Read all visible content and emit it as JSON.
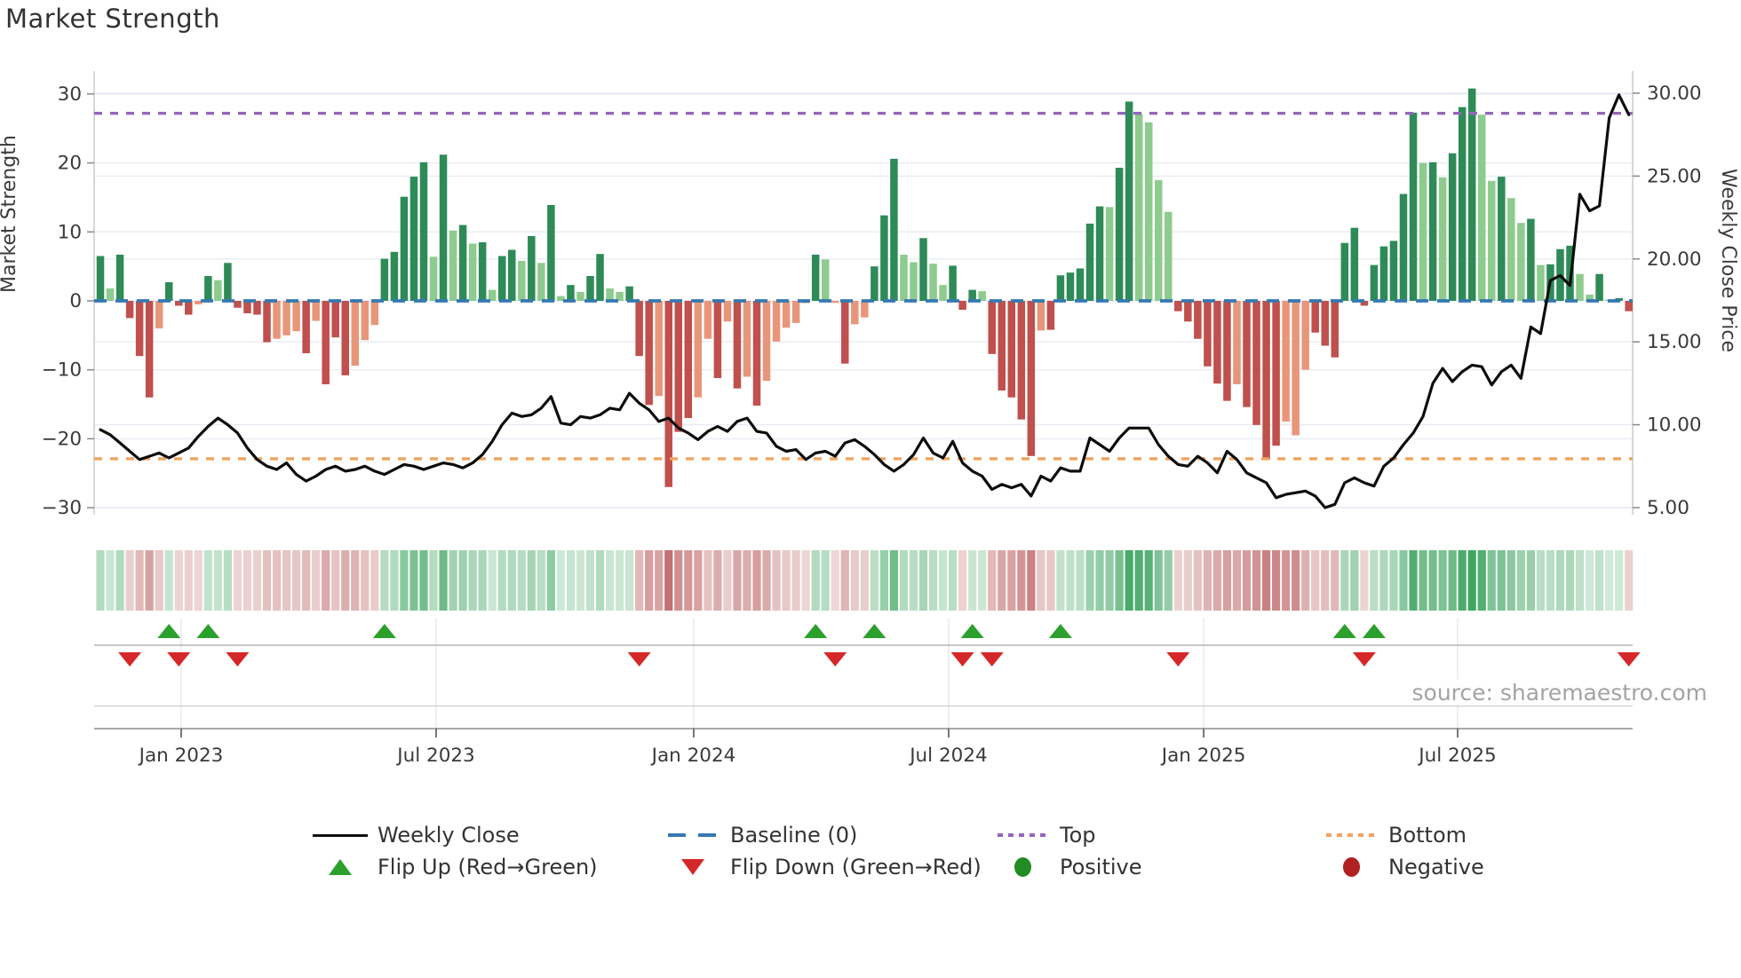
{
  "title": "Market Strength",
  "source_note": "source: sharemaestro.com",
  "axes": {
    "left_title": "Market Strength",
    "right_title": "Weekly Close Price",
    "left_tick_labels": [
      "30",
      "20",
      "10",
      "0",
      "−10",
      "−20",
      "−30"
    ],
    "left_tick_values": [
      30,
      20,
      10,
      0,
      -10,
      -20,
      -30
    ],
    "right_tick_labels": [
      "30.00",
      "25.00",
      "20.00",
      "15.00",
      "10.00",
      "5.00"
    ],
    "right_tick_values": [
      30,
      25,
      20,
      15,
      10,
      5
    ],
    "x_tick_labels": [
      "Jan 2023",
      "Jul 2023",
      "Jan 2024",
      "Jul 2024",
      "Jan 2025",
      "Jul 2025"
    ],
    "x_tick_week_pos": [
      8.25,
      34.27,
      60.56,
      86.58,
      112.61,
      138.53
    ]
  },
  "legend": {
    "weekly_close": "Weekly Close",
    "baseline": "Baseline (0)",
    "top": "Top",
    "bottom": "Bottom",
    "flip_up": "Flip Up (Red→Green)",
    "flip_down": "Flip Down (Green→Red)",
    "positive": "Positive",
    "negative": "Negative"
  },
  "colors": {
    "bar_dark_green": "#2e8b57",
    "bar_light_green": "#8ecb8e",
    "bar_dark_red": "#c0504d",
    "bar_light_red": "#e8967a",
    "price_line": "#0d0d0d",
    "baseline": "#3579b1",
    "top_line": "#9467bd",
    "bottom_line": "#f0a35e",
    "flip_up": "#2ca02c",
    "flip_down": "#d62728",
    "positive_dot": "#228B22",
    "negative_dot": "#b02121",
    "grid": "#e8ebf3",
    "spine": "#cfcfcf",
    "tick_text": "#3a3a3a"
  },
  "chart_data": {
    "type": "bar+line combo with heatmap strip and flip markers",
    "title": "Market Strength",
    "left_ylabel": "Market Strength",
    "right_ylabel": "Weekly Close Price",
    "left_ylim": [
      -31,
      32
    ],
    "right_ylim": [
      4.2,
      31.2
    ],
    "baseline_value": 0,
    "top_band_value": 27.2,
    "bottom_band_value": -22.9,
    "weeks": 157,
    "strength_values": [
      6.5,
      1.8,
      6.7,
      -2.5,
      -8,
      -14,
      -4,
      2.7,
      -0.7,
      -2,
      -0.5,
      3.6,
      3,
      5.5,
      -1,
      -1.8,
      -2,
      -6,
      -5.5,
      -5,
      -4.4,
      -7.6,
      -2.9,
      -12.1,
      -5.3,
      -10.8,
      -9.4,
      -5.7,
      -3.5,
      6.1,
      7.1,
      15.1,
      18,
      20.1,
      6.4,
      21.2,
      10.2,
      11,
      8.3,
      8.5,
      1.6,
      6.5,
      7.4,
      5.8,
      9.4,
      5.5,
      13.9,
      0.7,
      2.3,
      1.3,
      3.6,
      6.8,
      1.8,
      1.3,
      2.1,
      -8,
      -15.1,
      -13.8,
      -27,
      -19,
      -17,
      -14,
      -5.5,
      -11.2,
      -3,
      -12.7,
      -11,
      -15.2,
      -11.6,
      -5.9,
      -3.9,
      -3.2,
      -0.3,
      6.7,
      6,
      -0.3,
      -9.1,
      -3.4,
      -2.4,
      5,
      12.4,
      20.6,
      6.7,
      5.6,
      9.1,
      5.4,
      2.3,
      5.1,
      -1.3,
      1.6,
      1.4,
      -7.7,
      -13,
      -14,
      -17.2,
      -22.5,
      -4.3,
      -4.2,
      3.7,
      4.1,
      4.7,
      11.2,
      13.7,
      13.6,
      19.3,
      28.9,
      27.1,
      25.9,
      17.5,
      12.9,
      -1.5,
      -3,
      -5.5,
      -9.5,
      -12,
      -14.5,
      -12.1,
      -15.4,
      -18,
      -23,
      -21,
      -17.5,
      -19.5,
      -10,
      -4.6,
      -6.5,
      -8.2,
      8.4,
      10.6,
      -0.7,
      5.2,
      7.9,
      8.7,
      15.5,
      27.3,
      20,
      20.1,
      17.9,
      21.4,
      28.1,
      30.8,
      27,
      17.4,
      18,
      14.9,
      11.3,
      11.9,
      5.2,
      5.3,
      7.5,
      8,
      3.9,
      0.9,
      3.9,
      0.2,
      0.4,
      -1.5
    ],
    "strength_shades": [
      "dg",
      "lg",
      "dg",
      "dr",
      "dr",
      "dr",
      "lr",
      "dg",
      "dr",
      "dr",
      "lr",
      "dg",
      "lg",
      "dg",
      "dr",
      "dr",
      "dr",
      "dr",
      "lr",
      "lr",
      "lr",
      "dr",
      "lr",
      "dr",
      "dr",
      "dr",
      "lr",
      "lr",
      "lr",
      "dg",
      "dg",
      "dg",
      "dg",
      "dg",
      "lg",
      "dg",
      "lg",
      "dg",
      "lg",
      "dg",
      "lg",
      "dg",
      "dg",
      "lg",
      "dg",
      "lg",
      "dg",
      "lg",
      "dg",
      "lg",
      "dg",
      "dg",
      "lg",
      "lg",
      "dg",
      "dr",
      "dr",
      "lr",
      "dr",
      "dr",
      "dr",
      "lr",
      "lr",
      "dr",
      "lr",
      "dr",
      "lr",
      "dr",
      "lr",
      "lr",
      "lr",
      "lr",
      "dr",
      "dg",
      "lg",
      "lr",
      "dr",
      "lr",
      "lr",
      "dg",
      "dg",
      "dg",
      "lg",
      "lg",
      "dg",
      "lg",
      "lg",
      "dg",
      "dr",
      "dg",
      "lg",
      "dr",
      "dr",
      "dr",
      "dr",
      "dr",
      "lr",
      "dr",
      "dg",
      "dg",
      "dg",
      "dg",
      "dg",
      "lg",
      "dg",
      "dg",
      "lg",
      "lg",
      "lg",
      "lg",
      "dr",
      "dr",
      "dr",
      "dr",
      "dr",
      "dr",
      "lr",
      "dr",
      "dr",
      "dr",
      "dr",
      "lr",
      "lr",
      "lr",
      "dr",
      "dr",
      "dr",
      "dg",
      "dg",
      "dr",
      "dg",
      "dg",
      "dg",
      "dg",
      "dg",
      "lg",
      "dg",
      "lg",
      "dg",
      "dg",
      "dg",
      "lg",
      "lg",
      "dg",
      "lg",
      "lg",
      "dg",
      "lg",
      "dg",
      "dg",
      "dg",
      "lg",
      "lg",
      "dg",
      "lg",
      "dg",
      "dr"
    ],
    "weekly_close_values": [
      9.7,
      9.4,
      8.9,
      8.4,
      7.9,
      8.1,
      8.3,
      8.0,
      8.3,
      8.6,
      9.3,
      9.9,
      10.4,
      10.0,
      9.5,
      8.6,
      7.9,
      7.5,
      7.3,
      7.7,
      7.0,
      6.6,
      6.9,
      7.3,
      7.5,
      7.2,
      7.3,
      7.5,
      7.2,
      7.0,
      7.3,
      7.6,
      7.5,
      7.3,
      7.5,
      7.7,
      7.6,
      7.4,
      7.7,
      8.2,
      9.0,
      10.0,
      10.7,
      10.5,
      10.6,
      11.0,
      11.7,
      10.1,
      10.0,
      10.5,
      10.4,
      10.6,
      11.0,
      10.9,
      11.9,
      11.3,
      10.9,
      10.2,
      10.4,
      9.8,
      9.5,
      9.1,
      9.6,
      9.9,
      9.6,
      10.2,
      10.4,
      9.6,
      9.5,
      8.7,
      8.4,
      8.5,
      7.9,
      8.3,
      8.4,
      8.1,
      8.9,
      9.1,
      8.7,
      8.2,
      7.6,
      7.2,
      7.6,
      8.2,
      9.2,
      8.3,
      8.0,
      9.0,
      7.7,
      7.2,
      6.9,
      6.1,
      6.4,
      6.2,
      6.4,
      5.7,
      6.9,
      6.6,
      7.4,
      7.2,
      7.2,
      9.2,
      8.8,
      8.4,
      9.2,
      9.8,
      9.8,
      9.8,
      8.8,
      8.1,
      7.6,
      7.5,
      8.1,
      7.7,
      7.1,
      8.4,
      7.9,
      7.1,
      6.8,
      6.5,
      5.6,
      5.8,
      5.9,
      6.0,
      5.7,
      5.0,
      5.2,
      6.5,
      6.8,
      6.5,
      6.3,
      7.5,
      8.0,
      8.8,
      9.5,
      10.5,
      12.5,
      13.4,
      12.6,
      13.2,
      13.6,
      13.5,
      12.4,
      13.2,
      13.6,
      12.8,
      15.9,
      15.5,
      18.7,
      19.0,
      18.4,
      23.9,
      22.9,
      23.2,
      28.5,
      29.9,
      28.7
    ],
    "flip_up_week_idx": [
      7,
      11,
      29,
      73,
      79,
      89,
      98,
      127,
      130
    ],
    "flip_down_week_idx": [
      3,
      8,
      14,
      55,
      75,
      88,
      91,
      110,
      129,
      156
    ],
    "grid": "on",
    "legend_position": "bottom"
  }
}
